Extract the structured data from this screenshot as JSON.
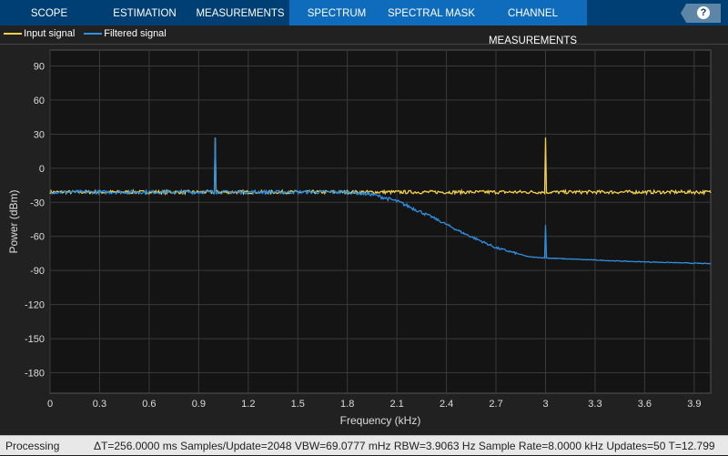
{
  "tabs": [
    {
      "label": "SCOPE"
    },
    {
      "label": "ESTIMATION"
    },
    {
      "label": "MEASUREMENTS"
    },
    {
      "label": "SPECTRUM",
      "selected": true
    },
    {
      "label": "SPECTRAL MASK",
      "selected": true
    },
    {
      "label": "CHANNEL MEASUREMENTS",
      "selected": true
    }
  ],
  "help_label": "?",
  "legend": [
    {
      "label": "Input signal",
      "color": "#f2d04b"
    },
    {
      "label": "Filtered signal",
      "color": "#2f8fe0"
    }
  ],
  "status": {
    "state": "Processing",
    "info": "ΔT=256.0000 ms  Samples/Update=2048  VBW=69.0777 mHz  RBW=3.9063 Hz  Sample Rate=8.0000 kHz  Updates=50  T=12.799"
  },
  "chart_data": {
    "type": "line",
    "xlabel": "Frequency (kHz)",
    "ylabel": "Power (dBm)",
    "xlim": [
      0,
      4.0
    ],
    "ylim": [
      -198,
      104
    ],
    "xticks": [
      "0",
      "0.3",
      "0.6",
      "0.9",
      "1.2",
      "1.5",
      "1.8",
      "2.1",
      "2.4",
      "2.7",
      "3",
      "3.3",
      "3.6",
      "3.9"
    ],
    "yticks": [
      "90",
      "60",
      "30",
      "0",
      "-30",
      "-60",
      "-90",
      "-120",
      "-150",
      "-180"
    ],
    "grid": true,
    "legend_position": "top-left",
    "series": [
      {
        "name": "Input signal",
        "noise_floor": -21,
        "peaks": [
          {
            "x": 1.0,
            "y": 27
          },
          {
            "x": 3.0,
            "y": 27
          }
        ],
        "x": [
          0,
          1.9,
          4.0
        ],
        "y": [
          -21,
          -21,
          -21
        ]
      },
      {
        "name": "Filtered signal",
        "peaks": [
          {
            "x": 1.0,
            "y": 27
          },
          {
            "x": 3.0,
            "y": -50
          }
        ],
        "x": [
          0,
          1.8,
          1.95,
          2.1,
          2.3,
          2.5,
          2.7,
          2.9,
          3.0,
          3.5,
          4.0
        ],
        "y": [
          -21,
          -21,
          -23,
          -29,
          -42,
          -57,
          -70,
          -78,
          -79,
          -82,
          -84
        ]
      }
    ]
  }
}
